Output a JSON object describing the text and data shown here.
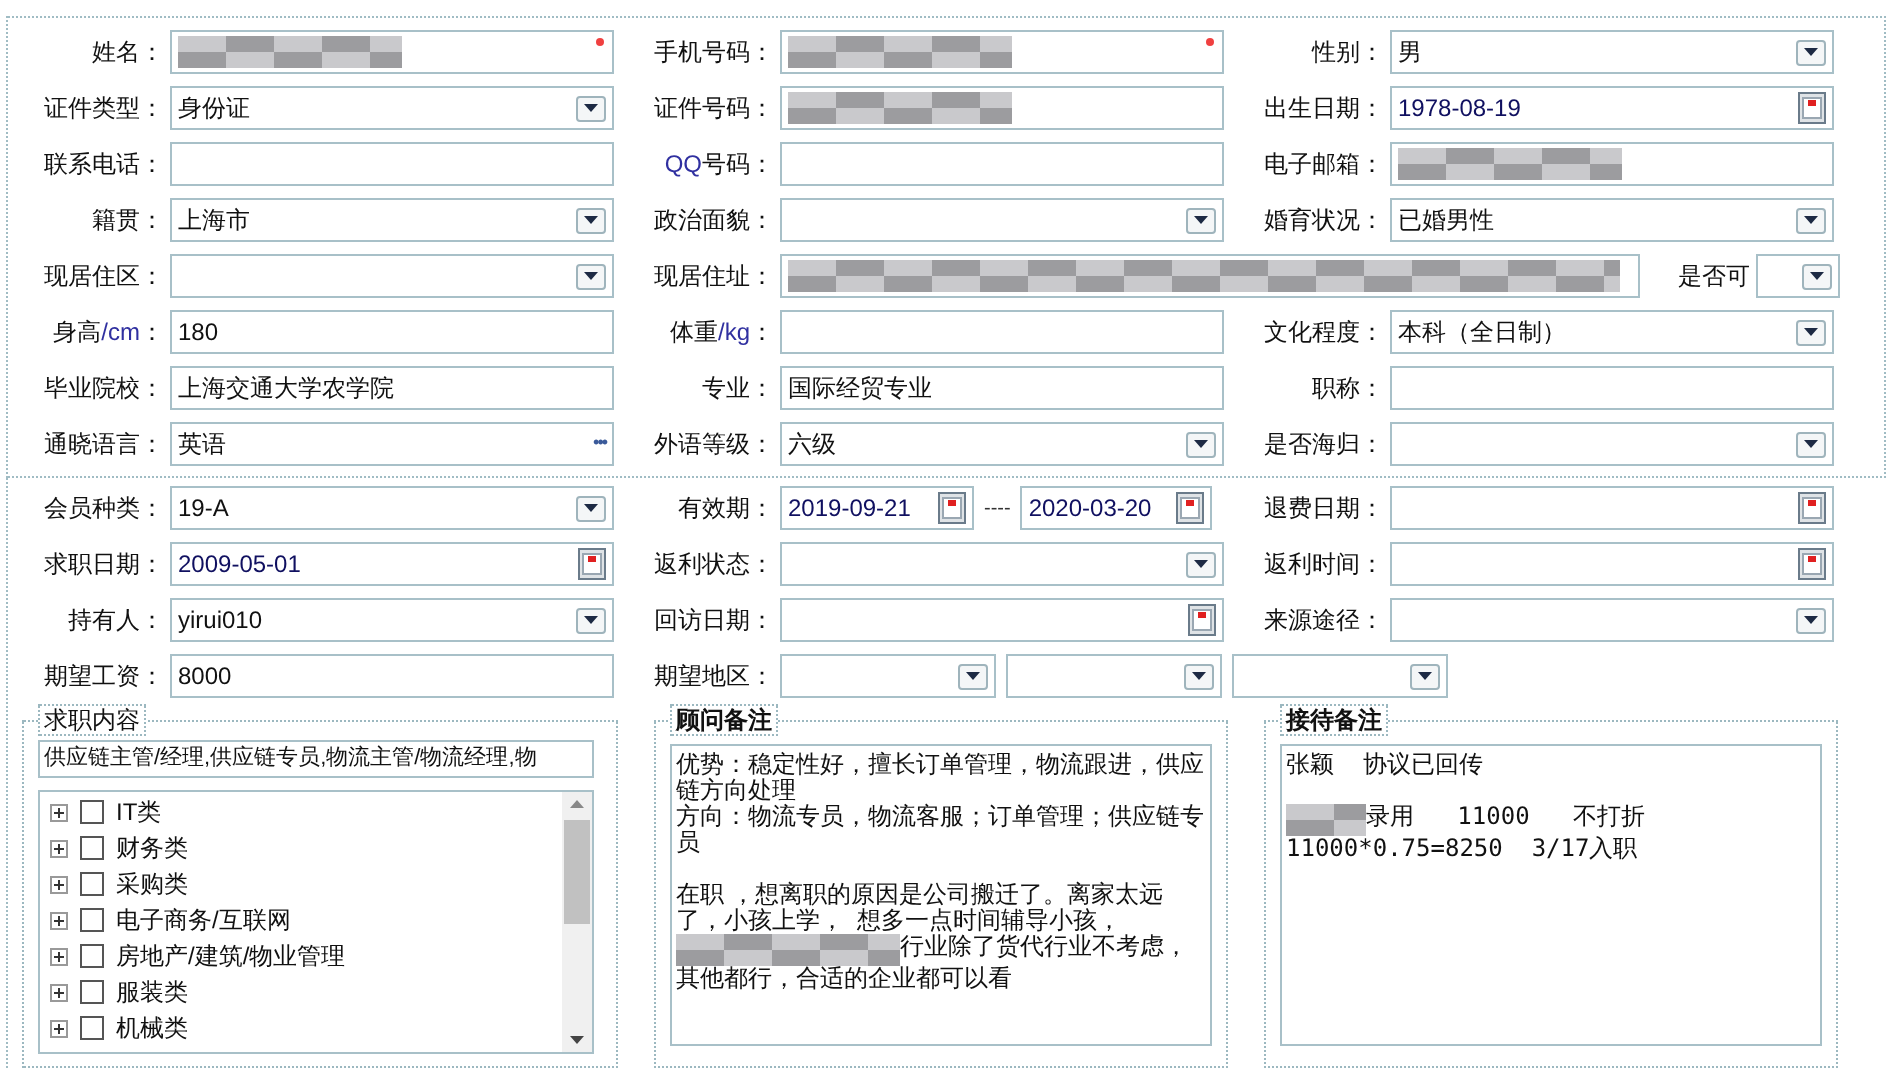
{
  "profile_rows": [
    [
      {
        "label": "姓名：",
        "kind": "masked",
        "required": true
      },
      {
        "label": "手机号码：",
        "kind": "masked",
        "required": true
      },
      {
        "label": "性别：",
        "kind": "select",
        "value": "男"
      }
    ],
    [
      {
        "label": "证件类型：",
        "kind": "select",
        "value": "身份证"
      },
      {
        "label": "证件号码：",
        "kind": "masked"
      },
      {
        "label": "出生日期：",
        "kind": "date",
        "value": "1978-08-19"
      }
    ],
    [
      {
        "label": "联系电话：",
        "kind": "text"
      },
      {
        "label_parts": [
          {
            "text": "QQ",
            "accent": true
          },
          {
            "text": "号码：",
            "accent": false
          }
        ],
        "kind": "text"
      },
      {
        "label": "电子邮箱：",
        "kind": "masked"
      }
    ],
    [
      {
        "label": "籍贯：",
        "kind": "select",
        "value": "上海市"
      },
      {
        "label": "政治面貌：",
        "kind": "select"
      },
      {
        "label": "婚育状况：",
        "kind": "select",
        "value": "已婚男性"
      }
    ],
    [
      {
        "label": "现居住区：",
        "kind": "select"
      },
      {
        "label": "现居住址：",
        "kind": "masked-wide"
      },
      {
        "label": "是否可",
        "kind": "select-small"
      }
    ],
    [
      {
        "label_parts": [
          {
            "text": "身高",
            "accent": false
          },
          {
            "text": "/cm",
            "accent": true
          },
          {
            "text": "：",
            "accent": false
          }
        ],
        "kind": "text",
        "value": "180"
      },
      {
        "label_parts": [
          {
            "text": "体重",
            "accent": false
          },
          {
            "text": "/kg",
            "accent": true
          },
          {
            "text": "：",
            "accent": false
          }
        ],
        "kind": "text"
      },
      {
        "label": "文化程度：",
        "kind": "select",
        "value": "本科（全日制）"
      }
    ],
    [
      {
        "label": "毕业院校：",
        "kind": "text",
        "value": "上海交通大学农学院"
      },
      {
        "label": "专业：",
        "kind": "text",
        "value": "国际经贸专业"
      },
      {
        "label": "职称：",
        "kind": "text"
      }
    ],
    [
      {
        "label": "通晓语言：",
        "kind": "lookup",
        "value": "英语",
        "button": "•••"
      },
      {
        "label": "外语等级：",
        "kind": "select",
        "value": "六级"
      },
      {
        "label": "是否海归：",
        "kind": "select"
      }
    ]
  ],
  "member_rows": [
    [
      {
        "label": "会员种类：",
        "kind": "select",
        "value": "19-A"
      },
      {
        "label": "有效期：",
        "kind": "daterange",
        "values": [
          "2019-09-21",
          "2020-03-20"
        ],
        "separator": "----"
      },
      {
        "label": "退费日期：",
        "kind": "date"
      }
    ],
    [
      {
        "label": "求职日期：",
        "kind": "date",
        "value": "2009-05-01"
      },
      {
        "label": "返利状态：",
        "kind": "select"
      },
      {
        "label": "返利时间：",
        "kind": "date"
      }
    ],
    [
      {
        "label": "持有人：",
        "kind": "select",
        "value": "yirui010"
      },
      {
        "label": "回访日期：",
        "kind": "date"
      },
      {
        "label": "来源途径：",
        "kind": "select"
      }
    ],
    [
      {
        "label": "期望工资：",
        "kind": "text",
        "value": "8000"
      },
      {
        "label": "期望地区：",
        "kind": "selects",
        "parts": [
          {
            "kind": "select"
          },
          {
            "kind": "select"
          },
          {
            "kind": "select"
          }
        ]
      }
    ]
  ],
  "job_content": {
    "legend": "求职内容",
    "summary": "供应链主管/经理,供应链专员,物流主管/物流经理,物",
    "tree": [
      {
        "label": "IT类",
        "checked": false,
        "expanded": false
      },
      {
        "label": "财务类",
        "checked": false,
        "expanded": false
      },
      {
        "label": "采购类",
        "checked": false,
        "expanded": false
      },
      {
        "label": "电子商务/互联网",
        "checked": false,
        "expanded": false
      },
      {
        "label": "房地产/建筑/物业管理",
        "checked": false,
        "expanded": false
      },
      {
        "label": "服装类",
        "checked": false,
        "expanded": false
      },
      {
        "label": "机械类",
        "checked": false,
        "expanded": false
      }
    ]
  },
  "consultant_note": {
    "legend": "顾问备注",
    "paragraphs": [
      {
        "spaced": false,
        "segments": [
          {
            "kind": "text",
            "text": "优势：稳定性好，擅长订单管理，物流跟进，供应链方向处理"
          }
        ]
      },
      {
        "spaced": false,
        "segments": [
          {
            "kind": "text",
            "text": "方向：物流专员，物流客服；订单管理；供应链专员"
          }
        ]
      },
      {
        "spaced": true,
        "segments": [
          {
            "kind": "text",
            "text": "在职 ，想离职的原因是公司搬迁了。离家太远了，小孩上学，  想多一点时间辅导小孩，"
          }
        ]
      },
      {
        "spaced": false,
        "segments": [
          {
            "kind": "masked"
          },
          {
            "kind": "text",
            "text": "行业除了货代行业不考虑，"
          }
        ]
      },
      {
        "spaced": false,
        "segments": [
          {
            "kind": "text",
            "text": "其他都行，合适的企业都可以看"
          }
        ]
      }
    ]
  },
  "reception_note": {
    "legend": "接待备注",
    "paragraphs": [
      {
        "spaced": false,
        "segments": [
          {
            "kind": "text",
            "text": "张颖  协议已回传"
          }
        ]
      },
      {
        "spaced": true,
        "segments": [
          {
            "kind": "masked"
          },
          {
            "kind": "text",
            "text": "录用   11000   不打折"
          }
        ]
      },
      {
        "spaced": false,
        "segments": [
          {
            "kind": "text",
            "text": "11000*0.75=8250  3/17入职"
          }
        ]
      }
    ]
  }
}
